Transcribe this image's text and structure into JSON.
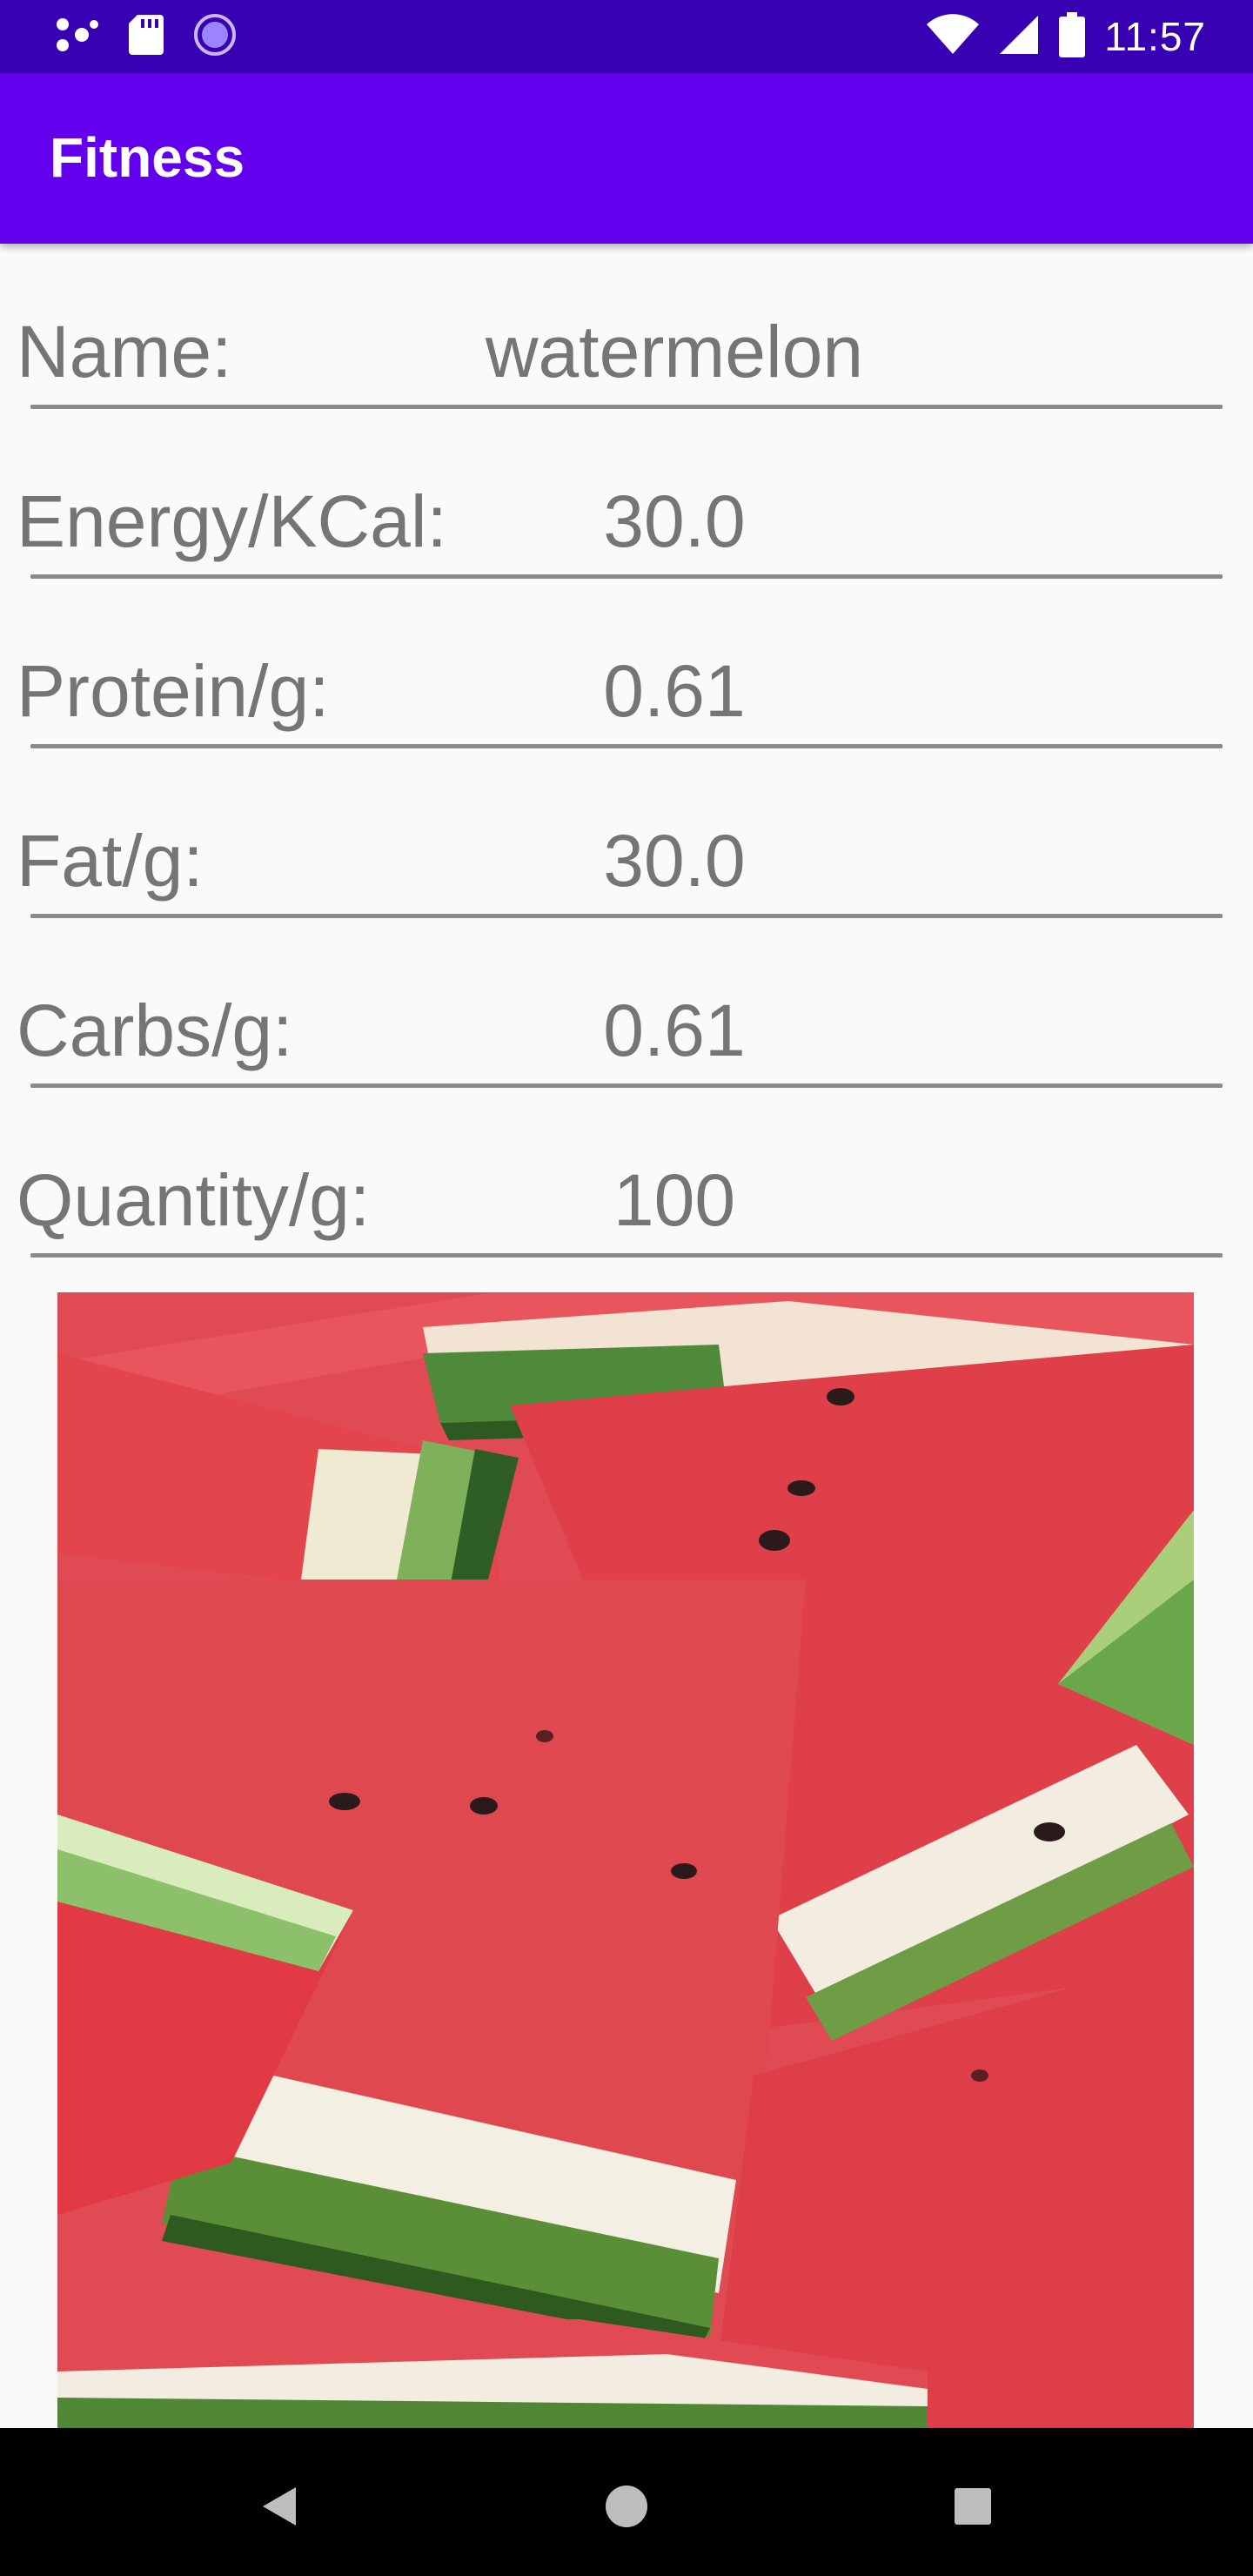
{
  "status_bar": {
    "time": "11:57",
    "left_icons": [
      "notification-dots-icon",
      "sd-card-icon",
      "sync-circle-icon"
    ],
    "right_icons": [
      "wifi-icon",
      "signal-icon",
      "battery-icon"
    ]
  },
  "app_bar": {
    "title": "Fitness",
    "color": "#6200ee",
    "status_color": "#3700b3"
  },
  "form": {
    "name": {
      "label": "Name:",
      "value": "watermelon"
    },
    "energy": {
      "label": "Energy/KCal:",
      "value": "30.0"
    },
    "protein": {
      "label": "Protein/g:",
      "value": "0.61"
    },
    "fat": {
      "label": "Fat/g:",
      "value": "30.0"
    },
    "carbs": {
      "label": "Carbs/g:",
      "value": "0.61"
    },
    "quantity": {
      "label": "Quantity/g:",
      "value": "100"
    }
  },
  "image": {
    "subject": "watermelon slices"
  },
  "nav_bar": {
    "icons": [
      "back-icon",
      "home-icon",
      "recents-icon"
    ]
  }
}
